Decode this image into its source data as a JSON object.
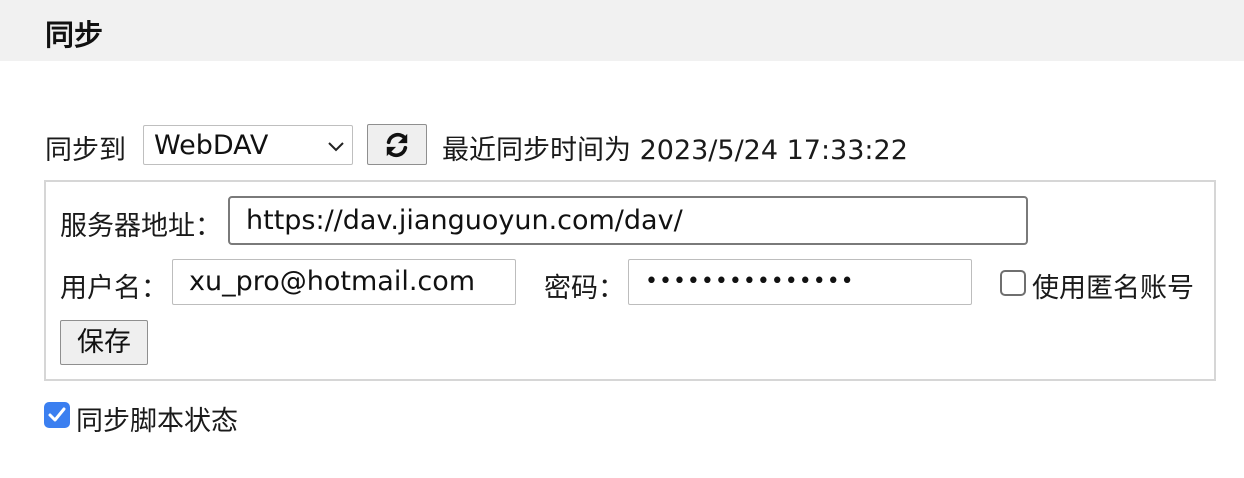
{
  "header": {
    "title": "同步"
  },
  "sync": {
    "label": "同步到",
    "target_selected": "WebDAV",
    "refresh_icon": "refresh-icon",
    "last_sync_text": "最近同步时间为 2023/5/24 17:33:22"
  },
  "webdav": {
    "server_label": "服务器地址：",
    "server_value": "https://dav.jianguoyun.com/dav/",
    "username_label": "用户名：",
    "username_value": "xu_pro@hotmail.com",
    "password_label": "密码：",
    "password_masked": "•••••••••••••••",
    "anonymous_label": "使用匿名账号",
    "anonymous_checked": false,
    "save_label": "保存"
  },
  "options": {
    "sync_script_state_label": "同步脚本状态",
    "sync_script_state_checked": true
  },
  "colors": {
    "header_bg": "#f1f1f1",
    "checkbox_accent": "#3b7ff0",
    "panel_border": "#d6d6d6"
  }
}
